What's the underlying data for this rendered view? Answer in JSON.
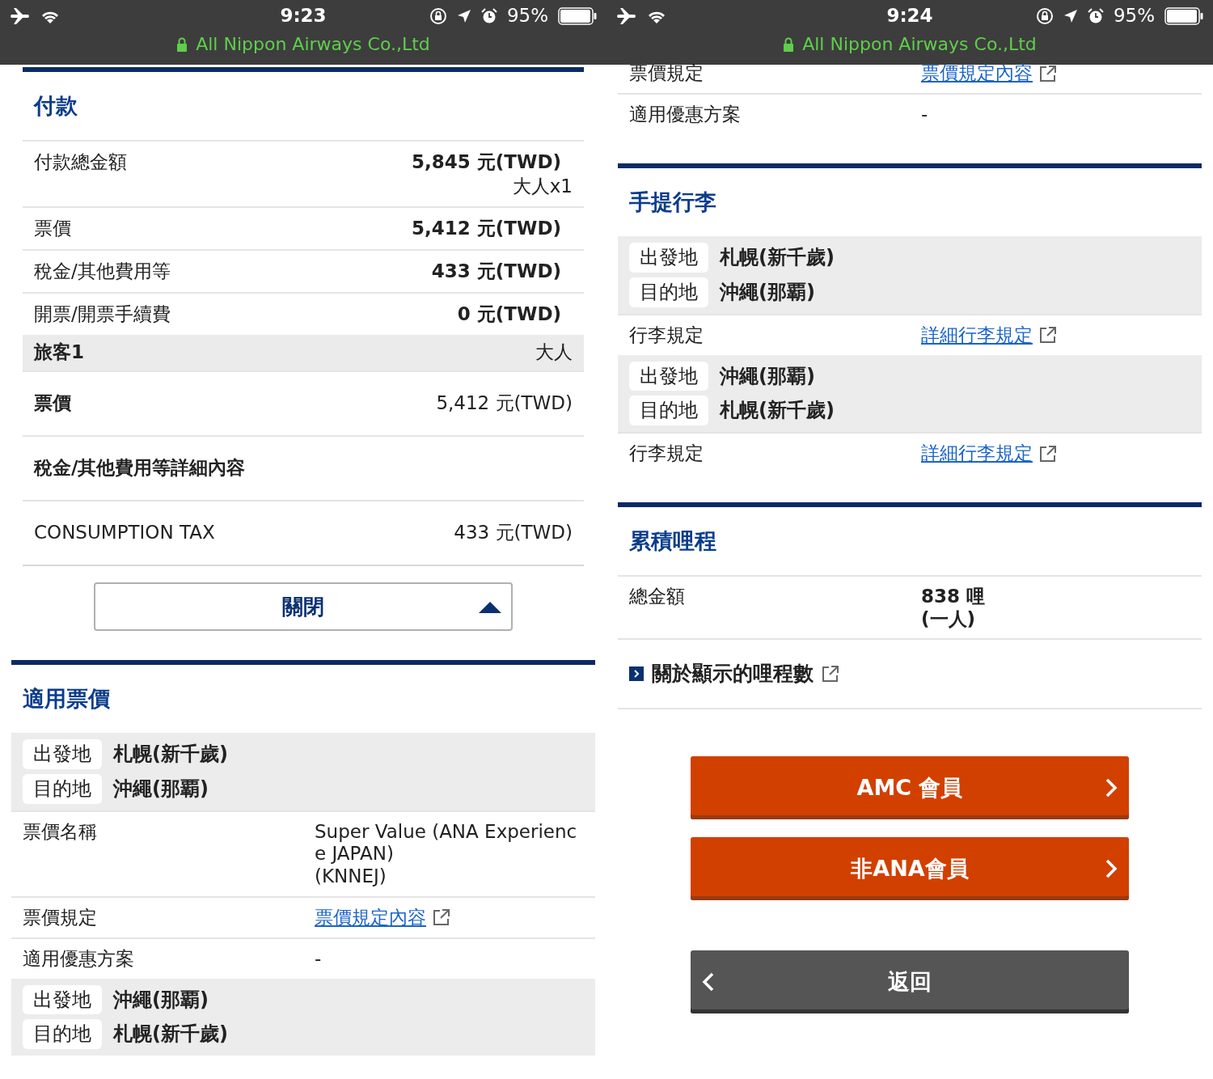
{
  "screens": [
    {
      "status_bar": {
        "time": "9:23",
        "battery": "95%"
      },
      "site": "All Nippon Airways Co.,Ltd",
      "sections": [
        {
          "kind": "payment",
          "title": "付款",
          "items": [
            {
              "kind": "amount",
              "label": "付款總金額",
              "value": "5,845 元(TWD)",
              "note": "大人x1"
            },
            {
              "kind": "amount",
              "label": "票價",
              "value": "5,412 元(TWD)"
            },
            {
              "kind": "amount",
              "label": "稅金/其他費用等",
              "value": "433 元(TWD)"
            },
            {
              "kind": "amount",
              "label": "開票/開票手續費",
              "value": "0 元(TWD)"
            },
            {
              "kind": "passenger",
              "label": "旅客1",
              "value": "大人"
            },
            {
              "kind": "fare",
              "label": "票價",
              "value": "5,412 元(TWD)"
            },
            {
              "kind": "subheading",
              "label": "稅金/其他費用等詳細內容"
            },
            {
              "kind": "tax",
              "label": "CONSUMPTION TAX",
              "value": "433 元(TWD)"
            },
            {
              "kind": "close",
              "label": "關閉"
            }
          ]
        },
        {
          "kind": "detail",
          "title": "適用票價",
          "items": [
            {
              "kind": "route",
              "legs": [
                {
                  "label": "出發地",
                  "place": "札幌(新千歲)"
                },
                {
                  "label": "目的地",
                  "place": "沖繩(那覇)"
                }
              ]
            },
            {
              "kind": "info",
              "label": "票價名稱",
              "lines": [
                "Super Value (ANA Experience JAPAN)",
                "(KNNEJ)"
              ]
            },
            {
              "kind": "link",
              "label": "票價規定",
              "link": "票價規定內容"
            },
            {
              "kind": "info",
              "label": "適用優惠方案",
              "lines": [
                "-"
              ]
            },
            {
              "kind": "route",
              "legs": [
                {
                  "label": "出發地",
                  "place": "沖繩(那覇)"
                },
                {
                  "label": "目的地",
                  "place": "札幌(新千歲)"
                }
              ]
            }
          ]
        }
      ]
    },
    {
      "status_bar": {
        "time": "9:24",
        "battery": "95%"
      },
      "site": "All Nippon Airways Co.,Ltd",
      "sections": [
        {
          "kind": "detail",
          "items": [
            {
              "kind": "link",
              "label": "票價規定",
              "link": "票價規定內容"
            },
            {
              "kind": "info",
              "label": "適用優惠方案",
              "lines": [
                "-"
              ]
            }
          ]
        },
        {
          "kind": "detail",
          "title": "手提行李",
          "items": [
            {
              "kind": "route",
              "legs": [
                {
                  "label": "出發地",
                  "place": "札幌(新千歲)"
                },
                {
                  "label": "目的地",
                  "place": "沖繩(那覇)"
                }
              ]
            },
            {
              "kind": "link",
              "label": "行李規定",
              "link": "詳細行李規定"
            },
            {
              "kind": "route",
              "legs": [
                {
                  "label": "出發地",
                  "place": "沖繩(那覇)"
                },
                {
                  "label": "目的地",
                  "place": "札幌(新千歲)"
                }
              ]
            },
            {
              "kind": "link",
              "label": "行李規定",
              "link": "詳細行李規定"
            }
          ]
        },
        {
          "kind": "detail",
          "title": "累積哩程",
          "items": [
            {
              "kind": "miles",
              "label": "總金額",
              "lines": [
                "838 哩",
                "(一人)"
              ]
            },
            {
              "kind": "about",
              "label": "關於顯示的哩程數"
            }
          ]
        }
      ],
      "buttons": [
        {
          "kind": "primary",
          "label": "AMC 會員"
        },
        {
          "kind": "primary",
          "label": "非ANA會員"
        },
        {
          "kind": "back",
          "label": "返回"
        }
      ]
    }
  ]
}
